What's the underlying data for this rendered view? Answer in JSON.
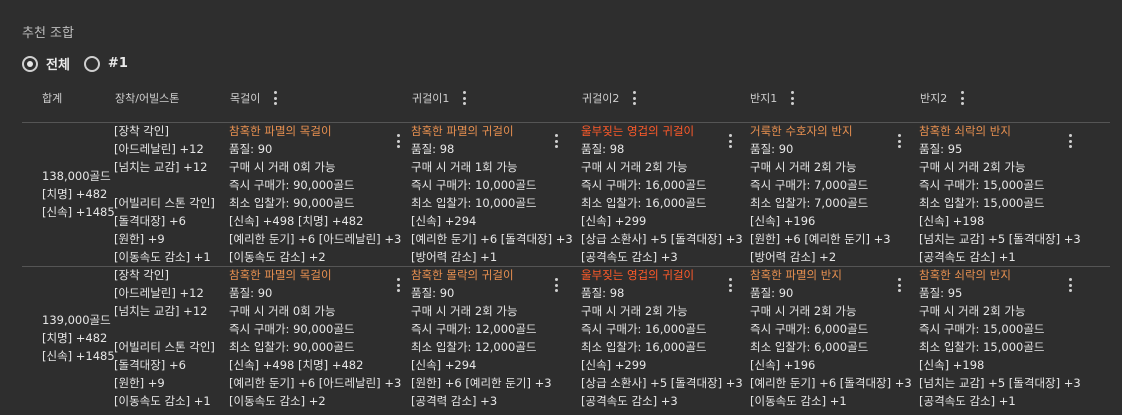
{
  "title": "추천 조합",
  "filters": [
    {
      "label": "전체",
      "selected": true
    },
    {
      "label": "#1",
      "selected": false
    }
  ],
  "headers": {
    "total": "합계",
    "engrave": "장착/어빌스톤",
    "necklace": "목걸이",
    "earring1": "귀걸이1",
    "earring2": "귀걸이2",
    "ring1": "반지1",
    "ring2": "반지2"
  },
  "rows": [
    {
      "total": {
        "price": "138,000골드",
        "stat1": "[치명] +482",
        "stat2": "[신속] +1485"
      },
      "engrave": {
        "title": "[장착 각인]",
        "lines": [
          "[아드레날린] +12",
          "[넘치는 교감] +12"
        ],
        "stone_title": "[어빌리티 스톤 각인]",
        "stone_lines": [
          "[돌격대장] +6",
          "[원한] +9",
          "[이동속도 감소] +1"
        ]
      },
      "items": [
        {
          "name": "참혹한 파멸의 목걸이",
          "tier": "relic",
          "quality": "품질: 90",
          "trade": "구매 시 거래 0회 가능",
          "buyout": "즉시 구매가: 90,000골드",
          "bid": "최소 입찰가: 90,000골드",
          "stats": "[신속] +498 [치명] +482",
          "eng": "[예리한 둔기] +6 [아드레날린] +3",
          "neg": "[이동속도 감소] +2"
        },
        {
          "name": "참혹한 파멸의 귀걸이",
          "tier": "relic",
          "quality": "품질: 98",
          "trade": "구매 시 거래 1회 가능",
          "buyout": "즉시 구매가: 10,000골드",
          "bid": "최소 입찰가: 10,000골드",
          "stats": "[신속] +294",
          "eng": "[예리한 둔기] +6 [돌격대장] +3",
          "neg": "[방어력 감소] +1"
        },
        {
          "name": "울부짖는 영겁의 귀걸이",
          "tier": "ancient",
          "quality": "품질: 98",
          "trade": "구매 시 거래 2회 가능",
          "buyout": "즉시 구매가: 16,000골드",
          "bid": "최소 입찰가: 16,000골드",
          "stats": "[신속] +299",
          "eng": "[상급 소환사] +5 [돌격대장] +3",
          "neg": "[공격속도 감소] +3"
        },
        {
          "name": "거룩한 수호자의 반지",
          "tier": "relic",
          "quality": "품질: 90",
          "trade": "구매 시 거래 2회 가능",
          "buyout": "즉시 구매가: 7,000골드",
          "bid": "최소 입찰가: 7,000골드",
          "stats": "[신속] +196",
          "eng": "[원한] +6 [예리한 둔기] +3",
          "neg": "[방어력 감소] +2"
        },
        {
          "name": "참혹한 쇠락의 반지",
          "tier": "relic",
          "quality": "품질: 95",
          "trade": "구매 시 거래 2회 가능",
          "buyout": "즉시 구매가: 15,000골드",
          "bid": "최소 입찰가: 15,000골드",
          "stats": "[신속] +198",
          "eng": "[넘치는 교감] +5 [돌격대장] +3",
          "neg": "[공격속도 감소] +1"
        }
      ]
    },
    {
      "total": {
        "price": "139,000골드",
        "stat1": "[치명] +482",
        "stat2": "[신속] +1485"
      },
      "engrave": {
        "title": "[장착 각인]",
        "lines": [
          "[아드레날린] +12",
          "[넘치는 교감] +12"
        ],
        "stone_title": "[어빌리티 스톤 각인]",
        "stone_lines": [
          "[돌격대장] +6",
          "[원한] +9",
          "[이동속도 감소] +1"
        ]
      },
      "items": [
        {
          "name": "참혹한 파멸의 목걸이",
          "tier": "relic",
          "quality": "품질: 90",
          "trade": "구매 시 거래 0회 가능",
          "buyout": "즉시 구매가: 90,000골드",
          "bid": "최소 입찰가: 90,000골드",
          "stats": "[신속] +498 [치명] +482",
          "eng": "[예리한 둔기] +6 [아드레날린] +3",
          "neg": "[이동속도 감소] +2"
        },
        {
          "name": "참혹한 몰락의 귀걸이",
          "tier": "relic",
          "quality": "품질: 90",
          "trade": "구매 시 거래 2회 가능",
          "buyout": "즉시 구매가: 12,000골드",
          "bid": "최소 입찰가: 12,000골드",
          "stats": "[신속] +294",
          "eng": "[원한] +6 [예리한 둔기] +3",
          "neg": "[공격력 감소] +3"
        },
        {
          "name": "울부짖는 영겁의 귀걸이",
          "tier": "ancient",
          "quality": "품질: 98",
          "trade": "구매 시 거래 2회 가능",
          "buyout": "즉시 구매가: 16,000골드",
          "bid": "최소 입찰가: 16,000골드",
          "stats": "[신속] +299",
          "eng": "[상급 소환사] +5 [돌격대장] +3",
          "neg": "[공격속도 감소] +3"
        },
        {
          "name": "참혹한 파멸의 반지",
          "tier": "relic",
          "quality": "품질: 90",
          "trade": "구매 시 거래 2회 가능",
          "buyout": "즉시 구매가: 6,000골드",
          "bid": "최소 입찰가: 6,000골드",
          "stats": "[신속] +196",
          "eng": "[예리한 둔기] +6 [돌격대장] +3",
          "neg": "[이동속도 감소] +1"
        },
        {
          "name": "참혹한 쇠락의 반지",
          "tier": "relic",
          "quality": "품질: 95",
          "trade": "구매 시 거래 2회 가능",
          "buyout": "즉시 구매가: 15,000골드",
          "bid": "최소 입찰가: 15,000골드",
          "stats": "[신속] +198",
          "eng": "[넘치는 교감] +5 [돌격대장] +3",
          "neg": "[공격속도 감소] +1"
        }
      ]
    }
  ],
  "colors": {
    "relic": "#e89050",
    "ancient": "#ff5a2a",
    "background": "#2e2e2e"
  },
  "icons": {
    "menu": "more-vert-icon",
    "radio": "radio-icon"
  }
}
